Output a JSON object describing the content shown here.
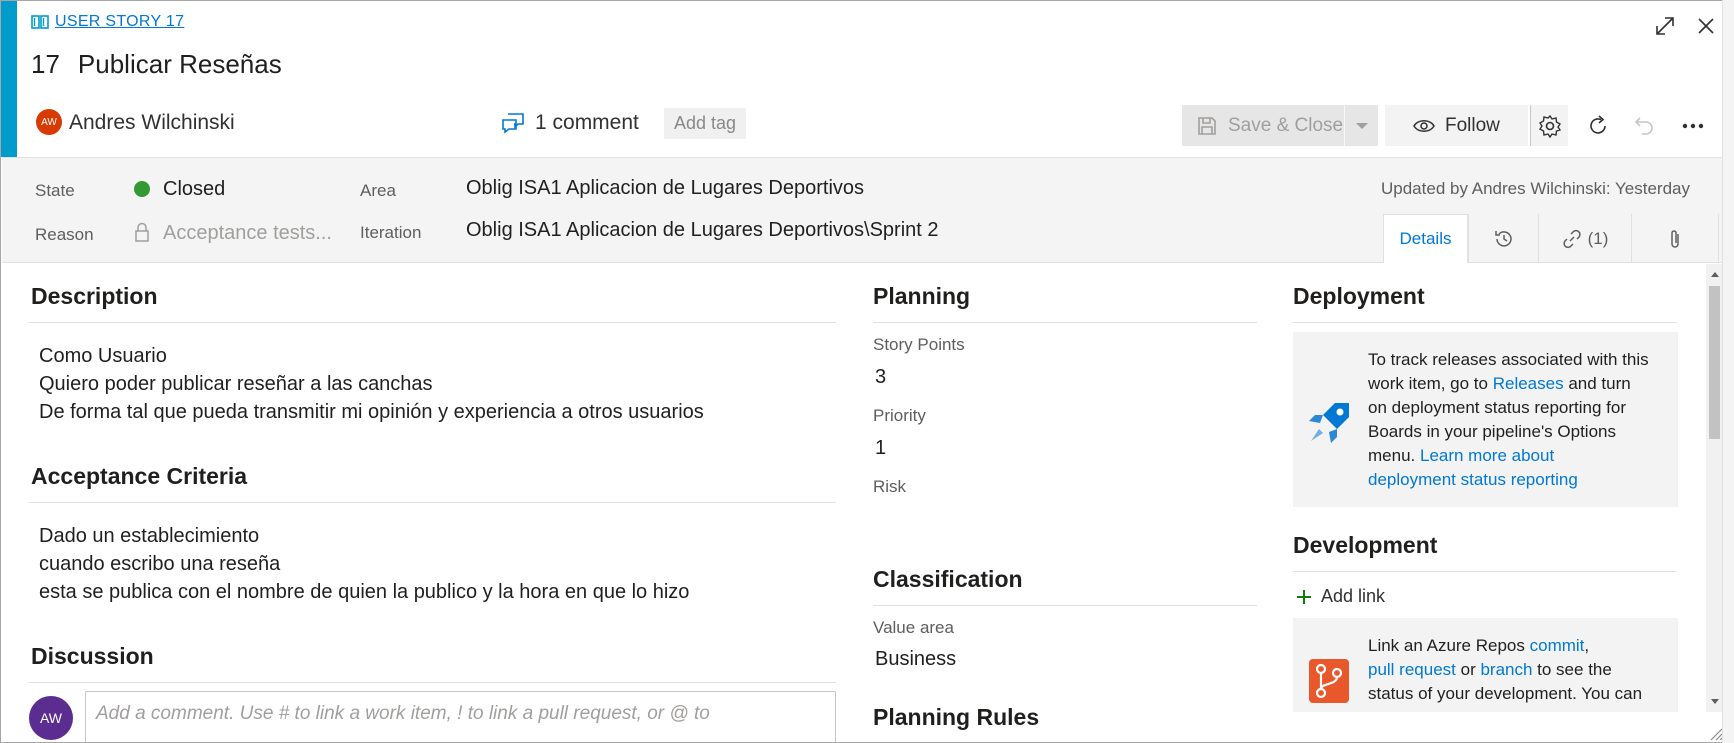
{
  "header": {
    "type_label": "USER STORY 17",
    "id": "17",
    "title": "Publicar Reseñas",
    "avatar_initials": "AW",
    "assignee": "Andres Wilchinski",
    "comments": "1 comment",
    "add_tag": "Add tag",
    "save_close": "Save & Close",
    "follow": "Follow"
  },
  "fields": {
    "state_label": "State",
    "state_value": "Closed",
    "reason_label": "Reason",
    "reason_value": "Acceptance tests...",
    "area_label": "Area",
    "area_value": "Oblig ISA1 Aplicacion de Lugares Deportivos",
    "iteration_label": "Iteration",
    "iteration_value": "Oblig ISA1 Aplicacion de Lugares Deportivos\\Sprint 2",
    "updated": "Updated by Andres Wilchinski: Yesterday"
  },
  "tabs": {
    "details": "Details",
    "links_count": "(1)"
  },
  "description": {
    "heading": "Description",
    "lines": [
      "Como Usuario",
      "Quiero poder publicar reseñar a las canchas",
      "De forma tal que pueda transmitir mi opinión y experiencia a otros usuarios"
    ]
  },
  "acceptance": {
    "heading": "Acceptance Criteria",
    "lines": [
      "Dado un establecimiento",
      "cuando escribo una reseña",
      "esta se publica con el nombre de quien la publico y la hora en que lo hizo"
    ]
  },
  "discussion": {
    "heading": "Discussion",
    "avatar_initials": "AW",
    "placeholder": "Add a comment. Use # to link a work item, ! to link a pull request, or @ to"
  },
  "planning": {
    "heading": "Planning",
    "story_points_label": "Story Points",
    "story_points_value": "3",
    "priority_label": "Priority",
    "priority_value": "1",
    "risk_label": "Risk"
  },
  "classification": {
    "heading": "Classification",
    "value_area_label": "Value area",
    "value_area_value": "Business",
    "next_heading_partial": "Planning Rules"
  },
  "deployment": {
    "heading": "Deployment",
    "l1": "To track releases associated with this",
    "l2a": "work item, go to ",
    "l2_link": "Releases",
    "l2b": " and turn",
    "l3": "on deployment status reporting for",
    "l4": "Boards in your pipeline's Options",
    "l5a": "menu. ",
    "l5_link": "Learn more about",
    "l6_link": "deployment status reporting"
  },
  "development": {
    "heading": "Development",
    "add_link": "Add link",
    "l1a": "Link an Azure Repos ",
    "l1_link": "commit",
    "l1b": ",",
    "l2_link1": "pull request",
    "l2b": " or ",
    "l2_link2": "branch",
    "l2c": " to see the",
    "l3": "status of your development. You can"
  },
  "colors": {
    "accent": "#009ccc",
    "link": "#0078d4",
    "closed": "#339933"
  }
}
